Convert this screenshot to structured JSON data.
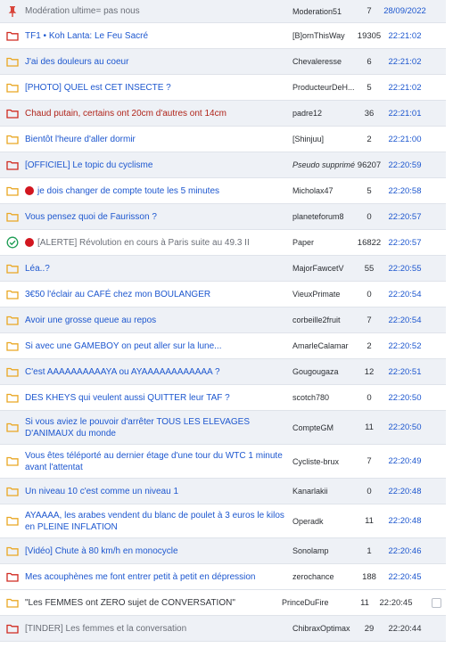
{
  "colors": {
    "link": "#1d57cf",
    "hot": "#b0241a",
    "pinned": "#d9453b",
    "folder_yellow": "#e9a723",
    "folder_red": "#d02a20",
    "resolved": "#1f9d55",
    "row_alt": "#eef1f6"
  },
  "topics": [
    {
      "icon": "pin-icon",
      "title": "Modération ultime= pas nous",
      "author": "Moderation51",
      "count": "7",
      "time": "28/09/2022"
    },
    {
      "icon": "folder-red-icon",
      "title": "TF1 • Koh Lanta: Le Feu Sacré",
      "author": "[B]ornThisWay",
      "count": "19305",
      "time": "22:21:02"
    },
    {
      "icon": "folder-yellow-icon",
      "title": "J'ai des douleurs au coeur",
      "author": "Chevaleresse",
      "count": "6",
      "time": "22:21:02"
    },
    {
      "icon": "folder-yellow-icon",
      "title": "[PHOTO] QUEL est CET INSECTE ?",
      "author": "ProducteurDeH...",
      "count": "5",
      "time": "22:21:02"
    },
    {
      "icon": "folder-red-icon",
      "title": "Chaud putain, certains ont 20cm d'autres ont 14cm",
      "author": "padre12",
      "count": "36",
      "time": "22:21:01"
    },
    {
      "icon": "folder-yellow-icon",
      "title": "Bientôt l'heure d'aller dormir",
      "author": "[Shinjuu]",
      "count": "2",
      "time": "22:21:00"
    },
    {
      "icon": "folder-red-icon",
      "title": "[OFFICIEL] Le topic du cyclisme",
      "author": "Pseudo supprimé",
      "count": "96207",
      "time": "22:20:59"
    },
    {
      "icon": "folder-yellow-icon",
      "title": "je dois changer de compte toute les 5 minutes",
      "author": "Micholax47",
      "count": "5",
      "time": "22:20:58"
    },
    {
      "icon": "folder-yellow-icon",
      "title": "Vous pensez quoi de Faurisson ?",
      "author": "planeteforum8",
      "count": "0",
      "time": "22:20:57"
    },
    {
      "icon": "check-circle-icon",
      "title": "[ALERTE] Révolution en cours à Paris suite au 49.3 II",
      "author": "Paper",
      "count": "16822",
      "time": "22:20:57"
    },
    {
      "icon": "folder-yellow-icon",
      "title": "Léa..?",
      "author": "MajorFawcetV",
      "count": "55",
      "time": "22:20:55"
    },
    {
      "icon": "folder-yellow-icon",
      "title": "3€50 l'éclair au CAFÉ chez mon BOULANGER",
      "author": "VieuxPrimate",
      "count": "0",
      "time": "22:20:54"
    },
    {
      "icon": "folder-yellow-icon",
      "title": "Avoir une grosse queue au repos",
      "author": "corbeille2fruit",
      "count": "7",
      "time": "22:20:54"
    },
    {
      "icon": "folder-yellow-icon",
      "title": "Si avec une GAMEBOY on peut aller sur la lune...",
      "author": "AmarleCalamar",
      "count": "2",
      "time": "22:20:52"
    },
    {
      "icon": "folder-yellow-icon",
      "title": "C'est AAAAAAAAAAYA ou AYAAAAAAAAAAAA ?",
      "author": "Gougougaza",
      "count": "12",
      "time": "22:20:51"
    },
    {
      "icon": "folder-yellow-icon",
      "title": "DES KHEYS qui veulent aussi QUITTER leur TAF ?",
      "author": "scotch780",
      "count": "0",
      "time": "22:20:50"
    },
    {
      "icon": "folder-yellow-icon",
      "title": "Si vous aviez le pouvoir d'arrêter TOUS LES ELEVAGES D'ANIMAUX du monde",
      "author": "CompteGM",
      "count": "11",
      "time": "22:20:50"
    },
    {
      "icon": "folder-yellow-icon",
      "title": "Vous êtes téléporté au dernier étage d'une tour du WTC 1 minute avant l'attentat",
      "author": "Cycliste-brux",
      "count": "7",
      "time": "22:20:49"
    },
    {
      "icon": "folder-yellow-icon",
      "title": "Un niveau 10 c'est comme un niveau 1",
      "author": "Kanarlakii",
      "count": "0",
      "time": "22:20:48"
    },
    {
      "icon": "folder-yellow-icon",
      "title": "AYAAAA, les arabes vendent du blanc de poulet à 3 euros le kilos en PLEINE INFLATION",
      "author": "Operadk",
      "count": "11",
      "time": "22:20:48"
    },
    {
      "icon": "folder-yellow-icon",
      "title": "[Vidéo] Chute à 80 km/h en monocycle",
      "author": "Sonolamp",
      "count": "1",
      "time": "22:20:46"
    },
    {
      "icon": "folder-red-icon",
      "title": "Mes acouphènes me font entrer petit à petit en dépression",
      "author": "zerochance",
      "count": "188",
      "time": "22:20:45"
    },
    {
      "icon": "folder-yellow-icon",
      "title": "\"Les FEMMES ont ZERO sujet de CONVERSATION\"",
      "author": "PrinceDuFire",
      "count": "11",
      "time": "22:20:45"
    },
    {
      "icon": "folder-red-icon",
      "title": "[TINDER] Les femmes et la conversation",
      "author": "ChibraxOptimax",
      "count": "29",
      "time": "22:20:44"
    }
  ]
}
